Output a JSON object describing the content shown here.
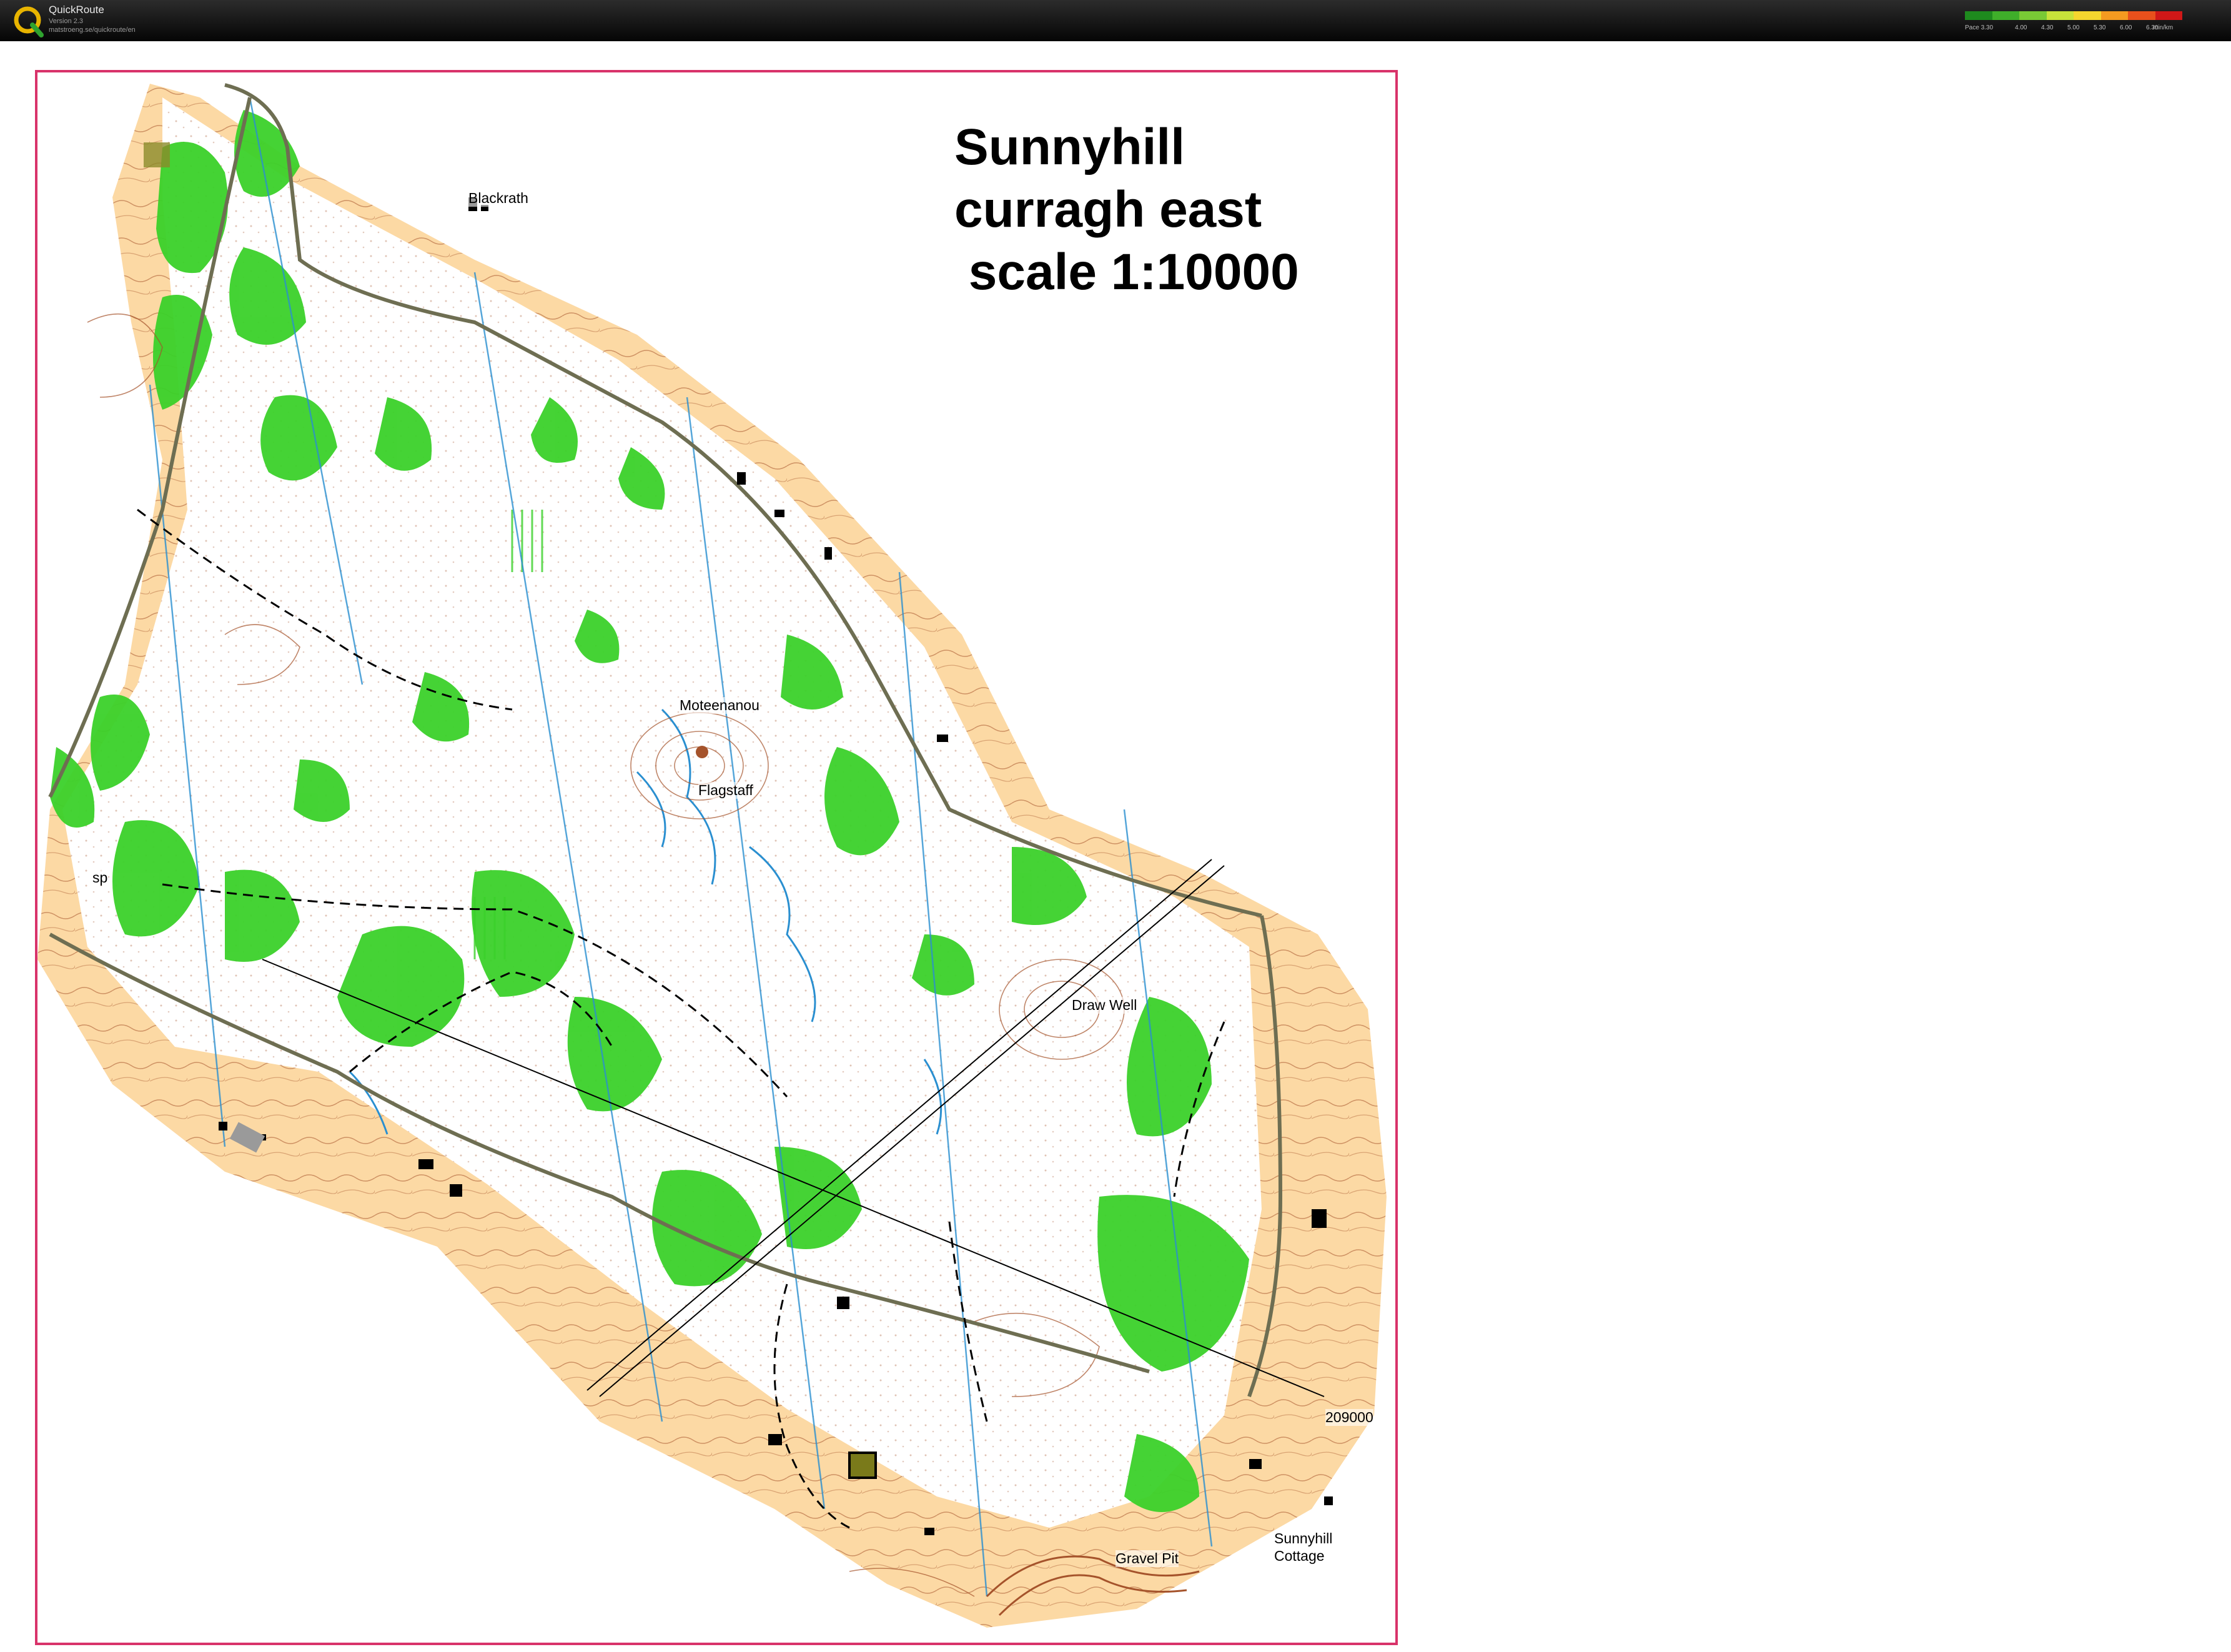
{
  "app": {
    "name": "QuickRoute",
    "version": "Version 2.3",
    "url": "matstroeng.se/quickroute/en"
  },
  "pace_legend": {
    "labels": [
      "Pace 3.30",
      "4.00",
      "4.30",
      "5.00",
      "5.30",
      "6.00",
      "6.30"
    ],
    "unit": "min/km",
    "colors": [
      "#1e8a1e",
      "#3fae2a",
      "#79c935",
      "#c7e23a",
      "#f5d62e",
      "#f59a20",
      "#e8501c",
      "#d01818"
    ]
  },
  "map": {
    "title_lines": [
      "Sunnyhill",
      "curragh east",
      " scale 1:10000"
    ],
    "place_names": {
      "blackrath": "Blackrath",
      "moteenanou": "Moteenanou",
      "flagstaff": "Flagstaff",
      "draw_well": "Draw Well",
      "gravel_pit": "Gravel Pit",
      "sunnyhill_cottage_1": "Sunnyhill",
      "sunnyhill_cottage_2": "Cottage",
      "grid_ref": "209000",
      "sp": "sp"
    },
    "colors": {
      "frame": "#d8336a",
      "open_land": "#fcd9a4",
      "forest_green": "#3bd12a",
      "contour": "#a5532b",
      "water": "#2a8fd0",
      "track": "#000000"
    }
  }
}
